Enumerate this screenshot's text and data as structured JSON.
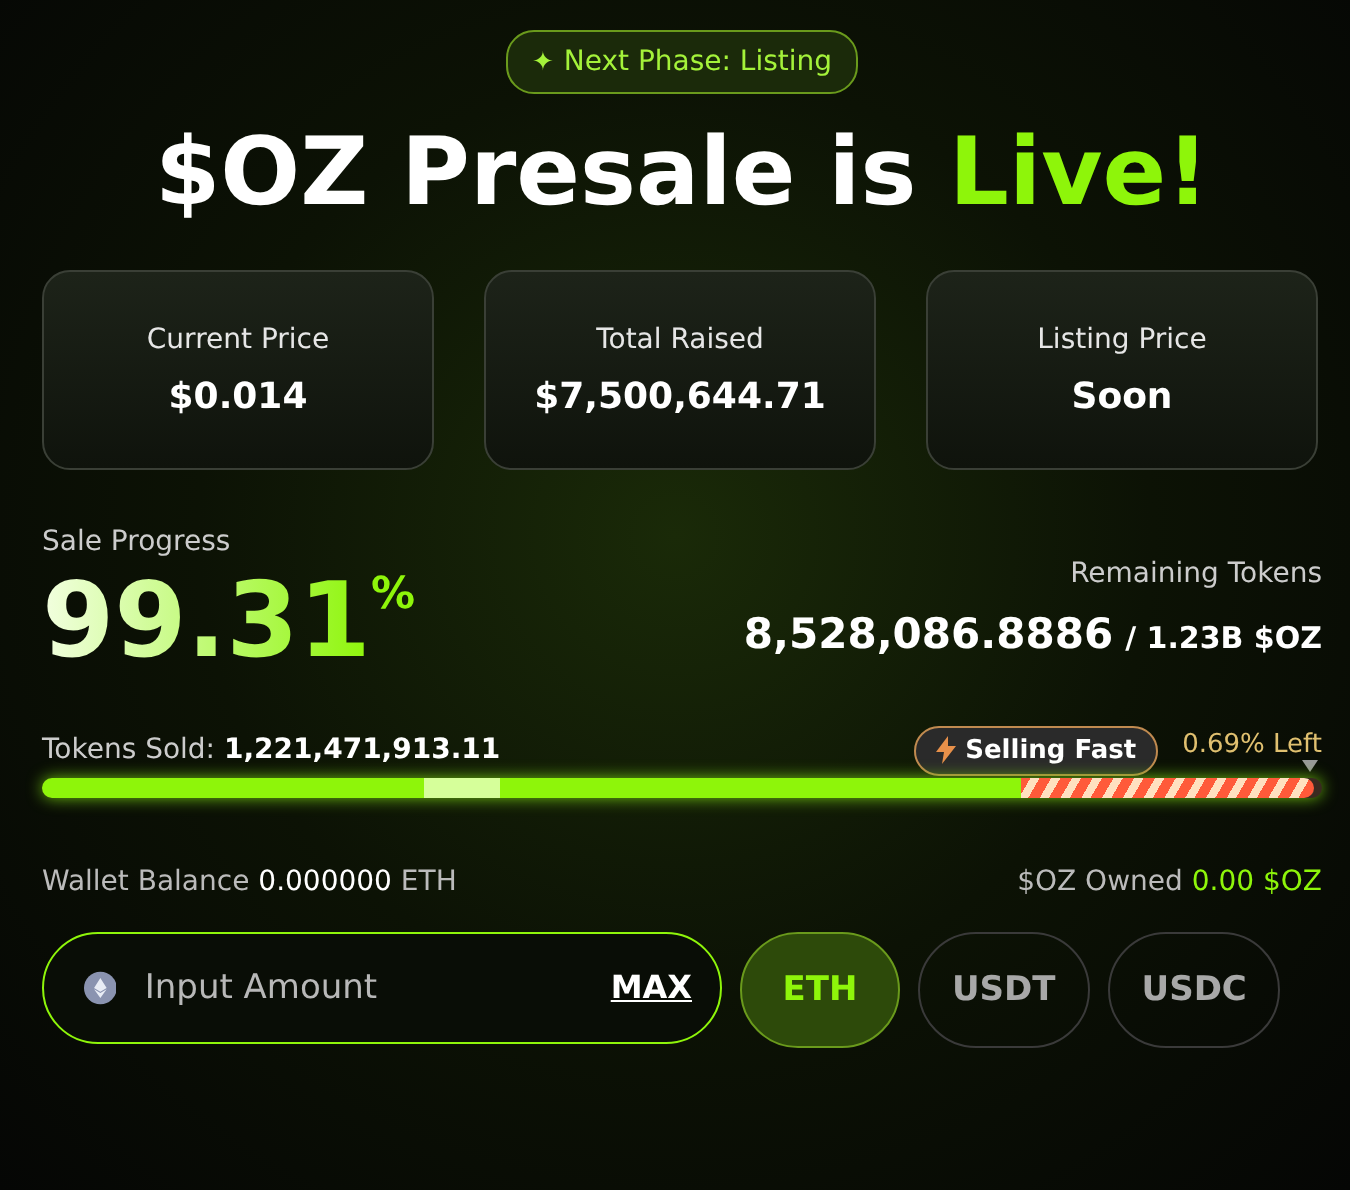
{
  "phase_badge": {
    "icon": "✦",
    "label": "Next Phase: Listing"
  },
  "headline": {
    "text": "$OZ Presale is",
    "highlight": "Live!"
  },
  "stats": [
    {
      "label": "Current Price",
      "value": "$0.014"
    },
    {
      "label": "Total Raised",
      "value": "$7,500,644.71"
    },
    {
      "label": "Listing Price",
      "value": "Soon"
    }
  ],
  "sale_progress": {
    "label": "Sale Progress",
    "percent": "99.31",
    "percent_sign": "%"
  },
  "remaining": {
    "label": "Remaining Tokens",
    "amount": "8,528,086.8886",
    "total": "/ 1.23B $OZ"
  },
  "tokens_sold": {
    "label": "Tokens Sold:",
    "value": "1,221,471,913.11"
  },
  "selling_badge": "Selling Fast",
  "left_label": "0.69% Left",
  "progress": {
    "level": 0.9931
  },
  "wallet": {
    "label": "Wallet Balance",
    "value": "0.000000",
    "unit": "ETH"
  },
  "owned": {
    "label": "$OZ Owned",
    "value": "0.00 $OZ"
  },
  "amount_field": {
    "placeholder": "Input Amount",
    "max_label": "MAX"
  },
  "currencies": [
    {
      "label": "ETH",
      "selected": true
    },
    {
      "label": "USDT",
      "selected": false
    },
    {
      "label": "USDC",
      "selected": false
    }
  ]
}
